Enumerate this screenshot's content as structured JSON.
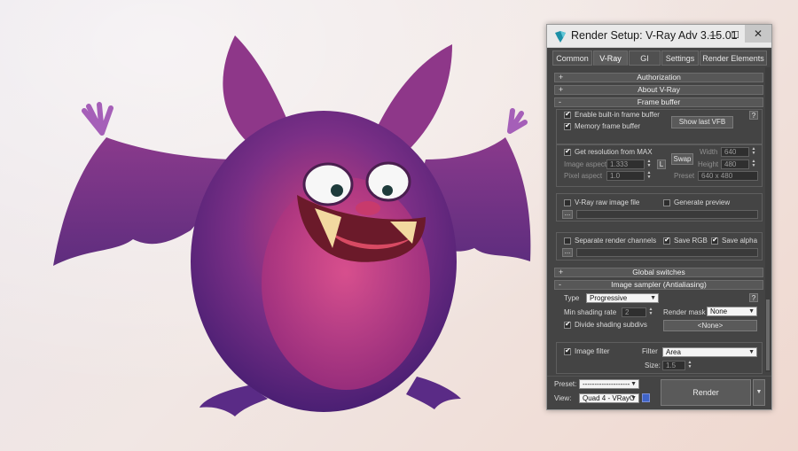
{
  "window": {
    "title": "Render Setup: V-Ray Adv 3.15.01",
    "min": "—",
    "max": "☐",
    "close": "✕"
  },
  "tabs": [
    "Common",
    "V-Ray",
    "GI",
    "Settings",
    "Render Elements"
  ],
  "active_tab": "V-Ray",
  "rollouts": {
    "authorization": {
      "sign": "+",
      "label": "Authorization"
    },
    "about": {
      "sign": "+",
      "label": "About V-Ray"
    },
    "frame_buffer": {
      "sign": "-",
      "label": "Frame buffer"
    },
    "global_switches": {
      "sign": "+",
      "label": "Global switches"
    },
    "image_sampler": {
      "sign": "-",
      "label": "Image sampler (Antialiasing)"
    }
  },
  "frame_buffer": {
    "enable_builtin": "Enable built-in frame buffer",
    "memory_fb": "Memory frame buffer",
    "show_last_vfb": "Show last VFB",
    "help": "?",
    "get_resolution": "Get resolution from MAX",
    "image_aspect_label": "Image aspect",
    "image_aspect_value": "1.333",
    "lock": "L",
    "pixel_aspect_label": "Pixel aspect",
    "pixel_aspect_value": "1.0",
    "swap": "Swap",
    "width_label": "Width",
    "width_value": "640",
    "height_label": "Height",
    "height_value": "480",
    "preset_label": "Preset",
    "preset_value": "640 x 480",
    "raw_image": "V-Ray raw image file",
    "generate_preview": "Generate preview",
    "browse": "...",
    "separate_channels": "Separate render channels",
    "save_rgb": "Save RGB",
    "save_alpha": "Save alpha"
  },
  "image_sampler": {
    "type_label": "Type",
    "type_value": "Progressive",
    "help": "?",
    "min_shading_label": "Min shading rate",
    "min_shading_value": "2",
    "render_mask_label": "Render mask",
    "render_mask_value": "None",
    "divide_subdivs": "Divide shading subdivs",
    "none_button": "<None>",
    "image_filter": "Image filter",
    "filter_label": "Filter",
    "filter_value": "Area",
    "size_label": "Size:",
    "size_value": "1.5"
  },
  "footer": {
    "preset_label": "Preset:",
    "preset_value": "--------------------",
    "view_label": "View:",
    "view_value": "Quad 4 - VRayC",
    "render": "Render"
  },
  "colors": {
    "panel_bg": "#444444",
    "rollout_bg": "#575757",
    "mascot_fur": "#b23a86",
    "mascot_body": "#6a2d8a"
  }
}
